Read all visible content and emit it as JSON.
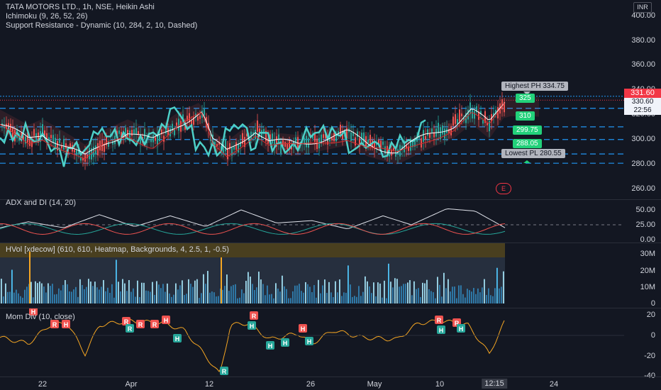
{
  "main": {
    "legend": [
      "TATA MOTORS LTD., 1h, NSE, Heikin Ashi",
      "Ichimoku (9, 26, 52, 26)",
      "Support Resistance - Dynamic (10, 284, 2, 10, Dashed)"
    ],
    "currency": "INR",
    "price_ticks": [
      "400.00",
      "380.00",
      "360.00",
      "340.00",
      "320.00",
      "300.00",
      "280.00",
      "260.00"
    ],
    "highest_label": "Highest PH 334.75",
    "lowest_label": "Lowest PL 280.55",
    "levels": [
      "325",
      "310",
      "299.75",
      "288.05"
    ],
    "event_marker": "E",
    "last_price_red": "331.60",
    "last_price_green": "330.60",
    "countdown": "22:56"
  },
  "adx": {
    "legend": "ADX and DI (14, 20)",
    "ticks": [
      "50.00",
      "25.00",
      "0.00"
    ]
  },
  "hvol": {
    "legend": "HVol [xdecow] (610, 610, Heatmap, Backgrounds, 4, 2.5, 1, -0.5)",
    "ticks": [
      "30M",
      "20M",
      "10M",
      "0"
    ]
  },
  "mom": {
    "legend": "Mom Div (10, close)",
    "ticks": [
      "20",
      "0",
      "-20",
      "-40"
    ]
  },
  "time_axis": [
    "22",
    "Apr",
    "12",
    "26",
    "May",
    "10",
    "12:15",
    "24"
  ],
  "colors": {
    "bg": "#131722",
    "up": "#26a69a",
    "down": "#ef5350",
    "level_line": "#2196f3",
    "tag_green": "#22d17a",
    "mom_line": "#f5a623"
  },
  "chart_data": [
    {
      "type": "line",
      "title": "TATA MOTORS LTD., 1h, NSE, Heikin Ashi",
      "x": [
        "22",
        "Apr",
        "12",
        "26",
        "May",
        "10",
        "12:15"
      ],
      "series": [
        {
          "values": [
            312,
            288,
            322,
            300,
            290,
            316,
            330.6
          ]
        }
      ],
      "ylim": [
        255,
        405
      ]
    },
    {
      "type": "line",
      "title": "ADX and DI (14, 20)",
      "x": [
        "22",
        "Apr",
        "12",
        "26",
        "May",
        "10",
        "12:15"
      ],
      "series": [
        {
          "values": [
            15,
            30,
            48,
            22,
            30,
            52,
            18
          ]
        }
      ],
      "ylim": [
        0,
        55
      ]
    },
    {
      "type": "bar",
      "title": "HVol [xdecow] (610, 610, Heatmap, Backgrounds, 4, 2.5, 1, -0.5)",
      "x": [
        "22",
        "Apr",
        "12",
        "26",
        "May",
        "10",
        "12:15"
      ],
      "series": [
        {
          "values": [
            14,
            22,
            30,
            14,
            10,
            14,
            18
          ]
        }
      ],
      "ylim": [
        0,
        37
      ]
    },
    {
      "type": "line",
      "title": "Mom Div (10, close)",
      "x": [
        "22",
        "Apr",
        "12",
        "26",
        "May",
        "10",
        "12:15"
      ],
      "series": [
        {
          "values": [
            -5,
            12,
            -40,
            5,
            -10,
            12,
            18
          ]
        }
      ],
      "ylim": [
        -40,
        25
      ]
    }
  ]
}
